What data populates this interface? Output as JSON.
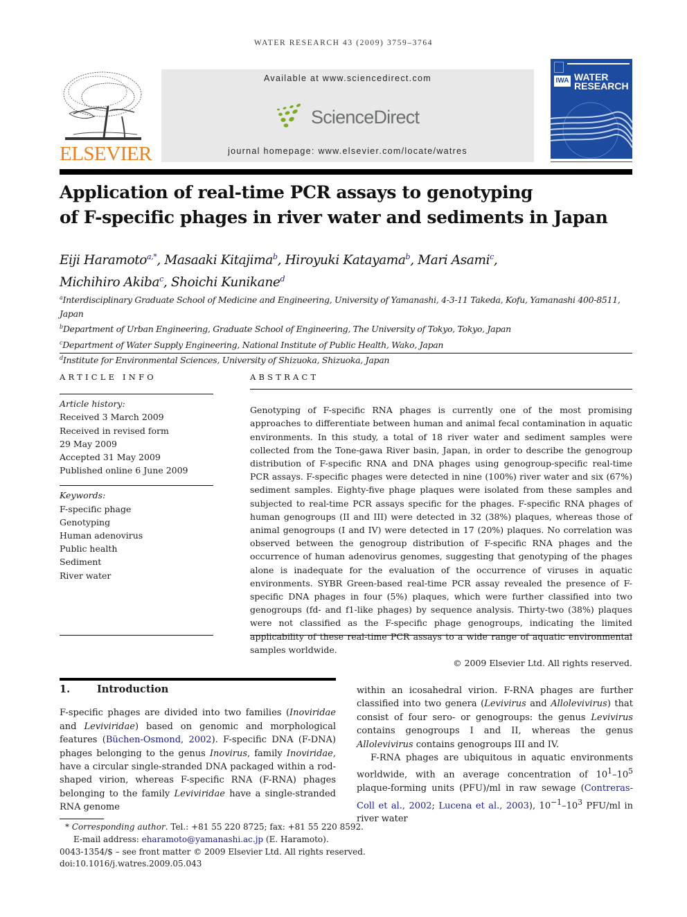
{
  "running_head": "WATER RESEARCH 43 (2009) 3759–3764",
  "header": {
    "publisher_logo_text": "ELSEVIER",
    "available_at": "Available at www.sciencedirect.com",
    "sciencedirect_wordmark": "ScienceDirect",
    "journal_homepage": "journal homepage: www.elsevier.com/locate/watres",
    "cover": {
      "badge": "IWA",
      "title_line1": "WATER",
      "title_line2": "RESEARCH",
      "color": "#1d4ba0"
    },
    "colors": {
      "elsevier_orange": "#f07f1b",
      "sd_green": "#7aab1e",
      "sd_grey": "#6b6f6d",
      "link_blue": "#1a1a8c"
    }
  },
  "title_line1": "Application of real-time PCR assays to genotyping",
  "title_line2": "of F-specific phages in river water and sediments in Japan",
  "authors": [
    {
      "name": "Eiji Haramoto",
      "sup": "a,*",
      "sep": ", "
    },
    {
      "name": "Masaaki Kitajima",
      "sup": "b",
      "sep": ", "
    },
    {
      "name": "Hiroyuki Katayama",
      "sup": "b",
      "sep": ", "
    },
    {
      "name": "Mari Asami",
      "sup": "c",
      "sep": ","
    },
    {
      "name": "Michihiro Akiba",
      "sup": "c",
      "sep": ", "
    },
    {
      "name": "Shoichi Kunikane",
      "sup": "d",
      "sep": ""
    }
  ],
  "affiliations": [
    {
      "key": "a",
      "text": "Interdisciplinary Graduate School of Medicine and Engineering, University of Yamanashi, 4-3-11 Takeda, Kofu, Yamanashi 400-8511, Japan"
    },
    {
      "key": "b",
      "text": "Department of Urban Engineering, Graduate School of Engineering, The University of Tokyo, Tokyo, Japan"
    },
    {
      "key": "c",
      "text": "Department of Water Supply Engineering, National Institute of Public Health, Wako, Japan"
    },
    {
      "key": "d",
      "text": "Institute for Environmental Sciences, University of Shizuoka, Shizuoka, Japan"
    }
  ],
  "article_info": {
    "label": "ARTICLE INFO",
    "history_label": "Article history:",
    "history": [
      "Received 3 March 2009",
      "Received in revised form",
      "29 May 2009",
      "Accepted 31 May 2009",
      "Published online 6 June 2009"
    ],
    "keywords_label": "Keywords:",
    "keywords": [
      "F-specific phage",
      "Genotyping",
      "Human adenovirus",
      "Public health",
      "Sediment",
      "River water"
    ]
  },
  "abstract": {
    "label": "ABSTRACT",
    "text": "Genotyping of F-specific RNA phages is currently one of the most promising approaches to differentiate between human and animal fecal contamination in aquatic environments. In this study, a total of 18 river water and sediment samples were collected from the Tone-gawa River basin, Japan, in order to describe the genogroup distribution of F-specific RNA and DNA phages using genogroup-specific real-time PCR assays. F-specific phages were detected in nine (100%) river water and six (67%) sediment samples. Eighty-five phage plaques were isolated from these samples and subjected to real-time PCR assays specific for the phages. F-specific RNA phages of human genogroups (II and III) were detected in 32 (38%) plaques, whereas those of animal genogroups (I and IV) were detected in 17 (20%) plaques. No correlation was observed between the genogroup distribution of F-specific RNA phages and the occurrence of human adenovirus genomes, suggesting that genotyping of the phages alone is inadequate for the evaluation of the occurrence of viruses in aquatic environments. SYBR Green-based real-time PCR assay revealed the presence of F-specific DNA phages in four (5%) plaques, which were further classified into two genogroups (fd- and f1-like phages) by sequence analysis. Thirty-two (38%) plaques were not classified as the F-specific phage genogroups, indicating the limited applicability of these real-time PCR assays to a wide range of aquatic environmental samples worldwide.",
    "copyright": "© 2009 Elsevier Ltd. All rights reserved."
  },
  "intro": {
    "number": "1.",
    "heading": "Introduction",
    "p1": {
      "t1": "F-specific phages are divided into two families (",
      "i1": "Inoviridae",
      "t2": " and ",
      "i2": "Leviviridae",
      "t3": ") based on genomic and morphological features (",
      "cite1": "Büchen-Osmond, 2002",
      "t4": "). F-specific DNA (F-DNA) phages belonging to the genus ",
      "i3": "Inovirus",
      "t5": ", family ",
      "i4": "Inoviridae",
      "t6": ", have a circular single-stranded DNA packaged within a rod-shaped virion, whereas F-specific RNA (F-RNA) phages belonging to the family ",
      "i5": "Leviviridae",
      "t7": " have a single-stranded RNA genome within an icosahedral virion. F-RNA phages are further classified into two genera (",
      "i6": "Levivirus",
      "t8": " and ",
      "i7": "Allolevivirus",
      "t9": ") that consist of four sero- or genogroups: the genus ",
      "i8": "Levivirus",
      "t10": " contains genogroups I and II, whereas the genus ",
      "i9": "Allolevivirus",
      "t11": " contains genogroups III and IV."
    },
    "p2": {
      "t1": "F-RNA phages are ubiquitous in aquatic environments worldwide, with an average concentration of 10",
      "sup1": "1",
      "t2": "–10",
      "sup2": "5",
      "t3": " plaque-forming units (PFU)/ml in raw sewage (",
      "cite1": "Contreras-Coll et al., 2002",
      "t4": "; ",
      "cite2": "Lucena et al., 2003",
      "t5": "), 10",
      "sup3": "−1",
      "t6": "–10",
      "sup4": "3",
      "t7": " PFU/ml in river water"
    }
  },
  "footnotes": {
    "star": "*",
    "corresponding_label": "Corresponding author",
    "contact": ". Tel.: +81 55 220 8725; fax: +81 55 220 8592.",
    "email_label": "E-mail address: ",
    "email": "eharamoto@yamanashi.ac.jp",
    "email_owner": " (E. Haramoto).",
    "issn_line": "0043-1354/$ – see front matter © 2009 Elsevier Ltd. All rights reserved.",
    "doi": "doi:10.1016/j.watres.2009.05.043"
  }
}
